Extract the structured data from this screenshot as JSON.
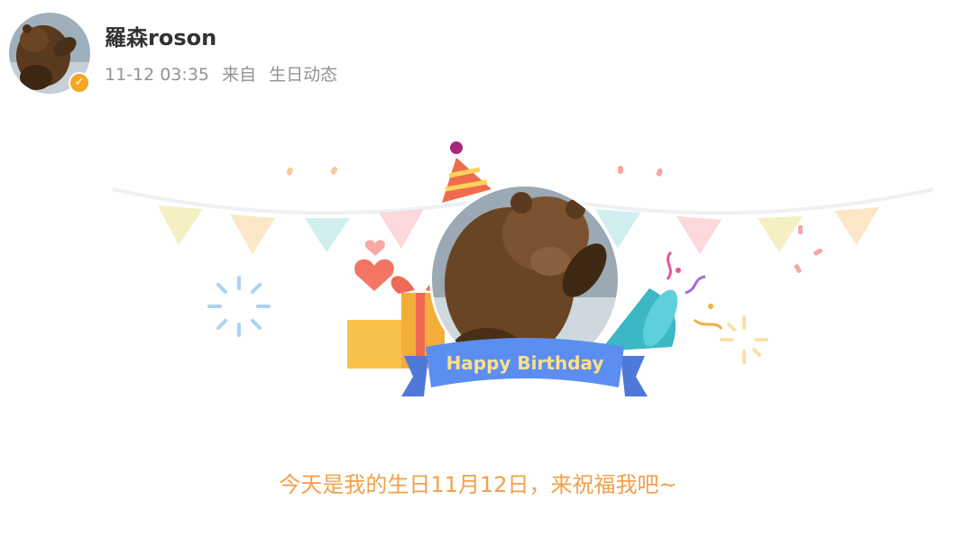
{
  "user": {
    "name": "羅森roson",
    "verified_icon": "verified-badge-icon",
    "verified_color": "#f5a623"
  },
  "post": {
    "time": "11-12 03:35",
    "source_prefix": "来自",
    "source_name": "生日动态"
  },
  "card": {
    "ribbon_text": "Happy Birthday",
    "wish_text": "今天是我的生日11月12日，来祝福我吧~"
  },
  "colors": {
    "ribbon": "#5b8ef0",
    "wish_text": "#f2a04b",
    "gift": "#f7b840",
    "party_horn": "#3bb8c4"
  }
}
